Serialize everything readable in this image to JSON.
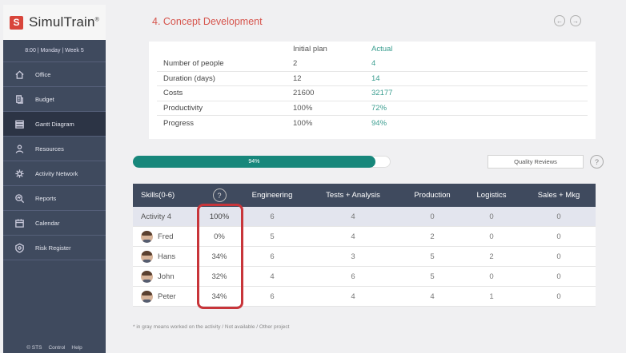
{
  "app": {
    "logo_text": "SimulTrain",
    "logo_mark": "S",
    "logo_reg": "®"
  },
  "sidebar": {
    "time": "8:00 | Monday | Week 5",
    "items": [
      {
        "label": "Office",
        "icon": "home-icon"
      },
      {
        "label": "Budget",
        "icon": "budget-icon"
      },
      {
        "label": "Gantt Diagram",
        "icon": "gantt-icon",
        "active": true
      },
      {
        "label": "Resources",
        "icon": "resources-icon"
      },
      {
        "label": "Activity Network",
        "icon": "network-icon"
      },
      {
        "label": "Reports",
        "icon": "reports-icon"
      },
      {
        "label": "Calendar",
        "icon": "calendar-icon"
      },
      {
        "label": "Risk Register",
        "icon": "risk-icon"
      }
    ],
    "footer": {
      "copyright": "© STS",
      "control": "Control",
      "help": "Help"
    }
  },
  "header": {
    "title": "4. Concept Development"
  },
  "plan": {
    "col_initial": "Initial plan",
    "col_actual": "Actual",
    "rows": [
      {
        "label": "Number of people",
        "initial": "2",
        "actual": "4"
      },
      {
        "label": "Duration (days)",
        "initial": "12",
        "actual": "14"
      },
      {
        "label": "Costs",
        "initial": "21600",
        "actual": "32177"
      },
      {
        "label": "Productivity",
        "initial": "100%",
        "actual": "72%"
      },
      {
        "label": "Progress",
        "initial": "100%",
        "actual": "94%"
      }
    ]
  },
  "progress": {
    "label": "94%",
    "value": 0.94
  },
  "quality_button": "Quality Reviews",
  "help_glyph": "?",
  "skills": {
    "headers": {
      "skills": "Skills(0-6)",
      "engineering": "Engineering",
      "tests": "Tests + Analysis",
      "production": "Production",
      "logistics": "Logistics",
      "sales": "Sales + Mkg"
    },
    "activity": {
      "name": "Activity 4",
      "pct": "100%",
      "engineering": "6",
      "tests": "4",
      "production": "0",
      "logistics": "0",
      "sales": "0"
    },
    "people": [
      {
        "name": "Fred",
        "pct": "0%",
        "engineering": "5",
        "tests": "4",
        "production": "2",
        "logistics": "0",
        "sales": "0"
      },
      {
        "name": "Hans",
        "pct": "34%",
        "engineering": "6",
        "tests": "3",
        "production": "5",
        "logistics": "2",
        "sales": "0"
      },
      {
        "name": "John",
        "pct": "32%",
        "engineering": "4",
        "tests": "6",
        "production": "5",
        "logistics": "0",
        "sales": "0"
      },
      {
        "name": "Peter",
        "pct": "34%",
        "engineering": "6",
        "tests": "4",
        "production": "4",
        "logistics": "1",
        "sales": "0"
      }
    ]
  },
  "footnote": "* in gray means worked on the activity / Not available / Other project",
  "colors": {
    "accent_red": "#d6544c",
    "teal": "#17877b",
    "sidebar": "#3f4a5e",
    "highlight": "#c8353a"
  }
}
